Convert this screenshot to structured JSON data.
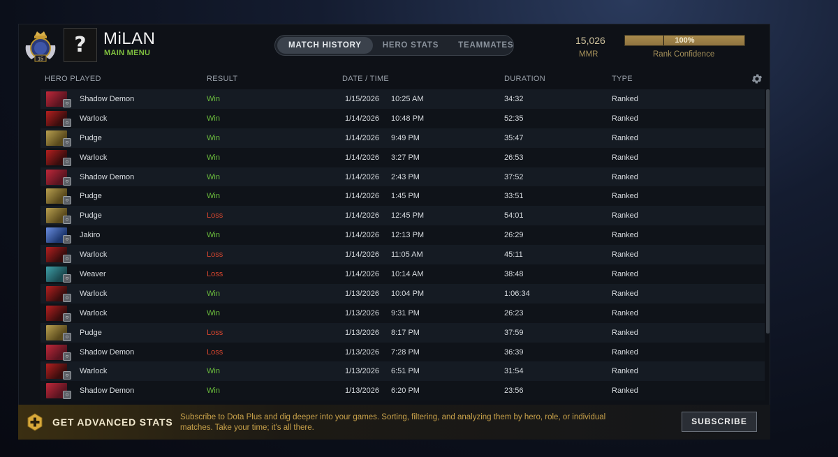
{
  "player": {
    "name": "MiLAN",
    "subtitle": "MAIN MENU",
    "avatar_glyph": "?",
    "badge_icon": "rank-medal-icon",
    "badge_number": "15"
  },
  "tabs": [
    {
      "label": "MATCH HISTORY",
      "active": true
    },
    {
      "label": "HERO STATS",
      "active": false
    },
    {
      "label": "TEAMMATES",
      "active": false
    }
  ],
  "mmr": {
    "value": "15,026",
    "label": "MMR"
  },
  "rank_confidence": {
    "value_text": "100%",
    "fraction": 1.0,
    "label": "Rank Confidence"
  },
  "table": {
    "headers": {
      "hero": "HERO PLAYED",
      "result": "RESULT",
      "datetime": "DATE / TIME",
      "duration": "DURATION",
      "type": "TYPE"
    },
    "rows": [
      {
        "hero": "Shadow Demon",
        "result": "Win",
        "date": "1/15/2026",
        "time": "10:25 AM",
        "duration": "34:32",
        "type": "Ranked"
      },
      {
        "hero": "Warlock",
        "result": "Win",
        "date": "1/14/2026",
        "time": "10:48 PM",
        "duration": "52:35",
        "type": "Ranked"
      },
      {
        "hero": "Pudge",
        "result": "Win",
        "date": "1/14/2026",
        "time": "9:49 PM",
        "duration": "35:47",
        "type": "Ranked"
      },
      {
        "hero": "Warlock",
        "result": "Win",
        "date": "1/14/2026",
        "time": "3:27 PM",
        "duration": "26:53",
        "type": "Ranked"
      },
      {
        "hero": "Shadow Demon",
        "result": "Win",
        "date": "1/14/2026",
        "time": "2:43 PM",
        "duration": "37:52",
        "type": "Ranked"
      },
      {
        "hero": "Pudge",
        "result": "Win",
        "date": "1/14/2026",
        "time": "1:45 PM",
        "duration": "33:51",
        "type": "Ranked"
      },
      {
        "hero": "Pudge",
        "result": "Loss",
        "date": "1/14/2026",
        "time": "12:45 PM",
        "duration": "54:01",
        "type": "Ranked"
      },
      {
        "hero": "Jakiro",
        "result": "Win",
        "date": "1/14/2026",
        "time": "12:13 PM",
        "duration": "26:29",
        "type": "Ranked"
      },
      {
        "hero": "Warlock",
        "result": "Loss",
        "date": "1/14/2026",
        "time": "11:05 AM",
        "duration": "45:11",
        "type": "Ranked"
      },
      {
        "hero": "Weaver",
        "result": "Loss",
        "date": "1/14/2026",
        "time": "10:14 AM",
        "duration": "38:48",
        "type": "Ranked"
      },
      {
        "hero": "Warlock",
        "result": "Win",
        "date": "1/13/2026",
        "time": "10:04 PM",
        "duration": "1:06:34",
        "type": "Ranked"
      },
      {
        "hero": "Warlock",
        "result": "Win",
        "date": "1/13/2026",
        "time": "9:31 PM",
        "duration": "26:23",
        "type": "Ranked"
      },
      {
        "hero": "Pudge",
        "result": "Loss",
        "date": "1/13/2026",
        "time": "8:17 PM",
        "duration": "37:59",
        "type": "Ranked"
      },
      {
        "hero": "Shadow Demon",
        "result": "Loss",
        "date": "1/13/2026",
        "time": "7:28 PM",
        "duration": "36:39",
        "type": "Ranked"
      },
      {
        "hero": "Warlock",
        "result": "Win",
        "date": "1/13/2026",
        "time": "6:51 PM",
        "duration": "31:54",
        "type": "Ranked"
      },
      {
        "hero": "Shadow Demon",
        "result": "Win",
        "date": "1/13/2026",
        "time": "6:20 PM",
        "duration": "23:56",
        "type": "Ranked"
      }
    ]
  },
  "hero_colors": {
    "Shadow Demon": [
      "#5a1420",
      "#c0283a"
    ],
    "Warlock": [
      "#3a0d0d",
      "#b52020"
    ],
    "Pudge": [
      "#5a4a1c",
      "#b8a050"
    ],
    "Jakiro": [
      "#1e3870",
      "#6a8ee0"
    ],
    "Weaver": [
      "#1a4a50",
      "#3fa0a8"
    ]
  },
  "colors": {
    "win": "#6bbd3c",
    "loss": "#d4452e",
    "accent_gold": "#a5905a"
  },
  "footer": {
    "title": "GET ADVANCED STATS",
    "text": "Subscribe to Dota Plus and dig deeper into your games. Sorting, filtering, and analyzing them by hero, role, or individual matches. Take your time; it's all there.",
    "button_label": "SUBSCRIBE",
    "icon": "dota-plus-icon"
  },
  "settings_icon": "gear-icon"
}
